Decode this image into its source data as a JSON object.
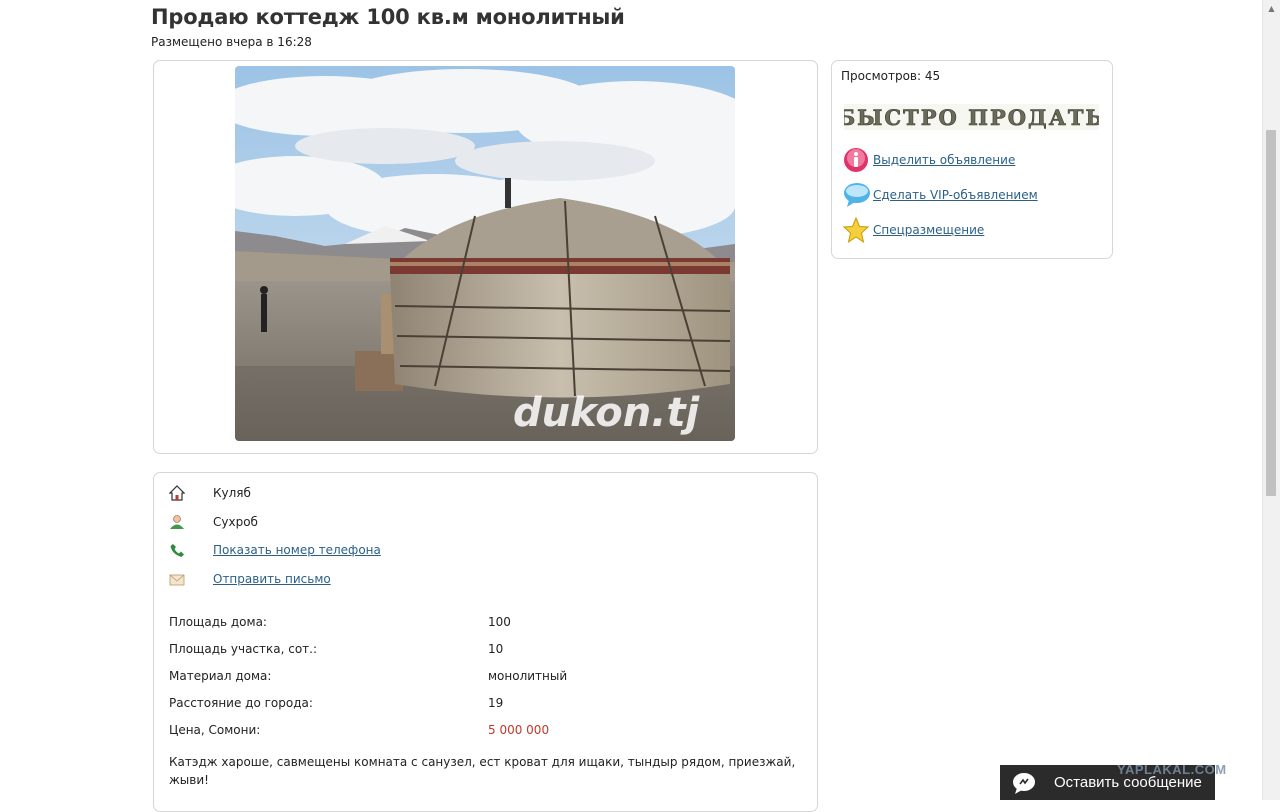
{
  "listing": {
    "title": "Продаю коттедж 100 кв.м монолитный",
    "posted": "Размещено вчера в 16:28",
    "photo_watermark": "dukon.tj"
  },
  "sidebar": {
    "views": "Просмотров: 45",
    "quick_sell": "БЫСТРО ПРОДАТЬ",
    "links": [
      {
        "label": "Выделить объявление",
        "icon": "info-icon"
      },
      {
        "label": "Сделать VIP-объявлением",
        "icon": "speech-bubble-icon"
      },
      {
        "label": "Спецразмещение",
        "icon": "star-icon"
      }
    ]
  },
  "contacts": {
    "city": "Куляб",
    "name": "Сухроб",
    "show_phone": "Показать номер телефона",
    "send_mail": "Отправить письмо"
  },
  "properties": [
    {
      "label": "Площадь дома:",
      "value": "100"
    },
    {
      "label": "Площадь участка, сот.:",
      "value": "10"
    },
    {
      "label": "Материал дома:",
      "value": "монолитный"
    },
    {
      "label": "Расстояние до города:",
      "value": "19"
    },
    {
      "label": "Цена, Сомони:",
      "value": "5 000 000"
    }
  ],
  "description": "Катэдж хароше, савмещены комната с санузел, ест кроват для ищаки, тындыр рядом, приезжай, жыви!",
  "footer": {
    "leave_message": "Оставить сообщение",
    "watermark": "YAPLAKAL.COM"
  },
  "colors": {
    "link": "#2b5f87",
    "price": "#c0392b",
    "quick_sell": "#6b6b5a"
  }
}
